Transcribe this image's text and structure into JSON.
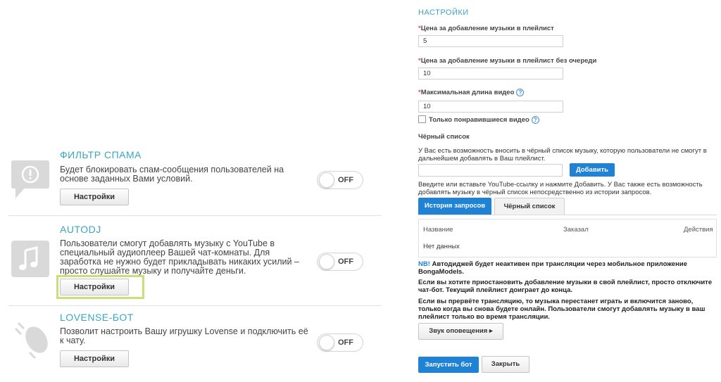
{
  "left": {
    "items": [
      {
        "title": "ФИЛЬТР СПАМА",
        "description": "Будет блокировать спам-сообщения пользователей на основе заданных Вами условий.",
        "toggle": "OFF",
        "settings_label": "Настройки",
        "icon": "spam-filter-icon"
      },
      {
        "title": "AUTODJ",
        "description": "Пользователи смогут добавлять музыку с YouTube в специальный аудиоплеер Вашей чат-комнаты. Для заработка не нужно будет прикладывать никаких усилий – просто слушайте музыку и получайте деньги.",
        "toggle": "OFF",
        "settings_label": "Настройки",
        "icon": "music-note-icon"
      },
      {
        "title": "LOVENSE-БОТ",
        "description": "Позволит настроить Вашу игрушку Lovense и подключить её к чату.",
        "toggle": "OFF",
        "settings_label": "Настройки",
        "icon": "lovense-toy-icon"
      }
    ],
    "highlight_color": "#c9e07a",
    "accent_color": "#3aa5c2"
  },
  "settings": {
    "title": "НАСТРОЙКИ",
    "price_label": "Цена за добавление музыки в плейлист",
    "price_value": "5",
    "priority_price_label": "Цена за добавление музыки в плейлист без очереди",
    "priority_price_value": "10",
    "max_length_label": "Максимальная длина видео",
    "max_length_value": "10",
    "liked_only_label": "Только понравившиеся видео",
    "blacklist_title": "Чёрный список",
    "blacklist_desc": "У Вас есть возможность вносить в чёрный список музыку, которую пользователи не смогут в дальнейшем добавлять в Ваш плейлист.",
    "blacklist_input_value": "",
    "add_button": "Добавить",
    "hint": "Введите или вставьте YouTube-ссылку и нажмите Добавить. У Вас также есть возможность добавлять музыку в чёрный список непосредственно из истории запросов.",
    "tabs": [
      "История запросов",
      "Чёрный список"
    ],
    "table": {
      "columns": [
        "Название",
        "Заказал",
        "Действия"
      ],
      "empty": "Нет данных"
    },
    "note_nb": "NB!",
    "note_1": " Автодиджей будет неактивен при трансляции через мобильное приложение BongaModels.",
    "note_2": "Если вы хотите приостановить добавление музыки в свой плейлист, просто отключите чат-бот. Текущий плейлист доиграет до конца.",
    "note_3": "Если вы прервёте трансляцию, то музыка перестанет играть и включится заново, только когда вы снова будете онлайн. Пользователи смогут добавлять музыку в ваш плейлист только во время трансляции.",
    "sound_button": "Звук оповещения ▸",
    "start_button": "Запустить бот",
    "close_button": "Закрыть",
    "button_blue": "#1f82d4"
  }
}
